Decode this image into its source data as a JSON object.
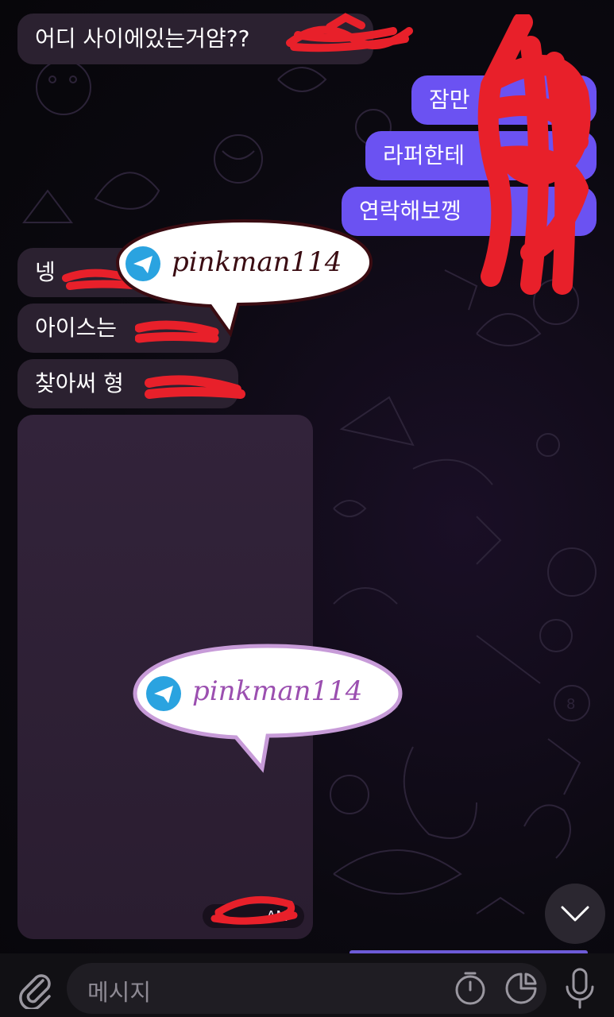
{
  "theme": {
    "incoming_bubble": "#2b2130",
    "outgoing_bubble": "#6b52f2",
    "background": "#0b0910",
    "redaction": "#e8202a"
  },
  "messages": {
    "m1": "어디 사이에있는거얌??",
    "m2": "잠만",
    "m3": "라퍼한테",
    "m4": "연락해보껭",
    "m5": "넹",
    "m6": "아이스는",
    "m7": "찾아써 형"
  },
  "media": {
    "time_suffix": "AM"
  },
  "watermarks": [
    {
      "handle": "pinkman114",
      "icon": "telegram-logo"
    },
    {
      "handle": "pinkman114",
      "icon": "telegram-logo"
    }
  ],
  "composer": {
    "placeholder": "메시지",
    "icons": [
      "attach-icon",
      "timer-icon",
      "sticker-icon",
      "microphone-icon"
    ]
  },
  "scroll_button": {
    "icon": "chevron-down-icon"
  }
}
